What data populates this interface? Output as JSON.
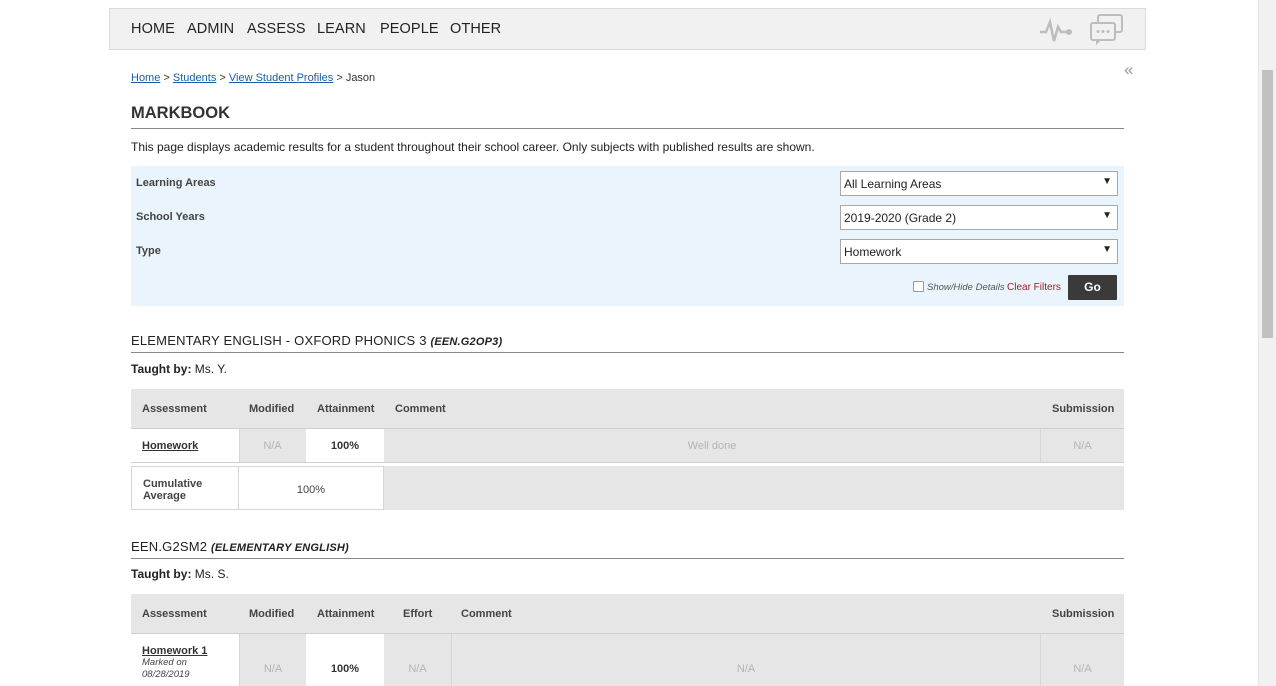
{
  "nav": {
    "items": [
      "HOME",
      "ADMIN",
      "ASSESS",
      "LEARN",
      "PEOPLE",
      "OTHER"
    ],
    "icons": [
      "activity-icon",
      "chat-icon"
    ]
  },
  "breadcrumb": {
    "home": "Home",
    "students": "Students",
    "profiles": "View Student Profiles",
    "sep": ">",
    "current": "Jason"
  },
  "page": {
    "title": "MARKBOOK",
    "description": "This page displays academic results for a student throughout their school career. Only subjects with published results are shown."
  },
  "filters": {
    "learning_areas_label": "Learning Areas",
    "learning_areas_value": "All Learning Areas",
    "school_years_label": "School Years",
    "school_years_value": "2019-2020 (Grade 2)",
    "type_label": "Type",
    "type_value": "Homework",
    "show_hide_label": "Show/Hide Details",
    "clear_label": "Clear Filters",
    "go_label": "Go"
  },
  "course1": {
    "title": "ELEMENTARY ENGLISH - OXFORD PHONICS 3",
    "code": "(EEN.G2OP3)",
    "taught_label": "Taught by:",
    "teacher": "Ms. Y.",
    "headers": [
      "Assessment",
      "Modified",
      "Attainment",
      "Comment",
      "Submission"
    ],
    "row": {
      "assessment": "Homework",
      "modified": "N/A",
      "attainment": "100%",
      "comment": "Well done",
      "submission": "N/A"
    },
    "cumulative_label": "Cumulative Average",
    "cumulative_value": "100%"
  },
  "course2": {
    "title": "EEN.G2SM2",
    "code": "(ELEMENTARY ENGLISH)",
    "taught_label": "Taught by:",
    "teacher": "Ms. S.",
    "headers": [
      "Assessment",
      "Modified",
      "Attainment",
      "Effort",
      "Comment",
      "Submission"
    ],
    "row": {
      "assessment": "Homework 1",
      "marked_on": "Marked on",
      "marked_date": "08/28/2019",
      "modified": "N/A",
      "attainment": "100%",
      "effort": "N/A",
      "comment": "N/A",
      "submission": "N/A"
    }
  },
  "collapse_label": "«"
}
